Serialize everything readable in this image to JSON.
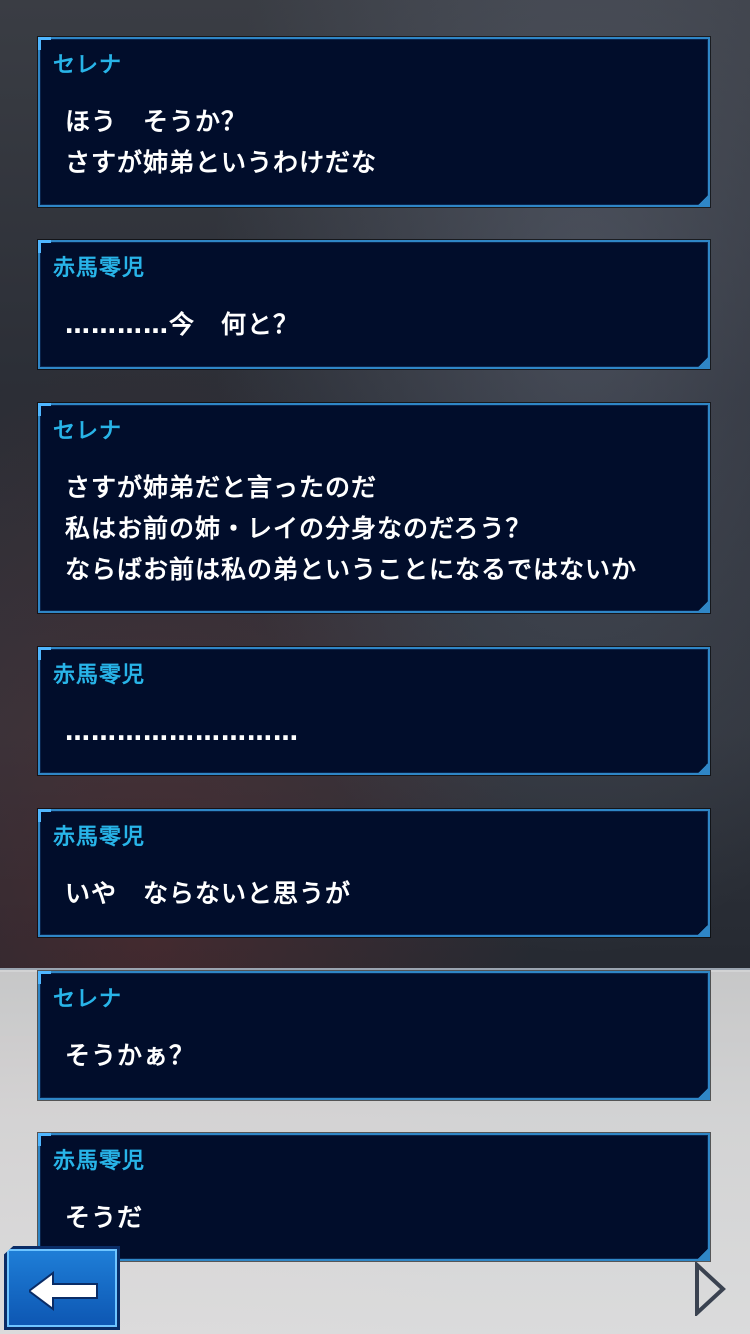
{
  "dialogue": [
    {
      "speaker": "セレナ",
      "text": "ほう　そうか？\nさすが姉弟というわけだな"
    },
    {
      "speaker": "赤馬零児",
      "text": "…………今　何と？"
    },
    {
      "speaker": "セレナ",
      "text": "さすが姉弟だと言ったのだ\n私はお前の姉・レイの分身なのだろう？\nならばお前は私の弟ということになるではないか"
    },
    {
      "speaker": "赤馬零児",
      "text": "………………………"
    },
    {
      "speaker": "赤馬零児",
      "text": "いや　ならないと思うが"
    },
    {
      "speaker": "セレナ",
      "text": "そうかぁ？"
    },
    {
      "speaker": "赤馬零児",
      "text": "そうだ"
    }
  ],
  "controls": {
    "back_icon": "left-arrow-icon",
    "next_icon": "right-triangle-icon"
  },
  "colors": {
    "panel_bg": "#010d2b",
    "panel_border": "#2f86c6",
    "speaker_name": "#28b4e8",
    "dialogue_text": "#ffffff",
    "back_button": "#1f7fd8"
  }
}
